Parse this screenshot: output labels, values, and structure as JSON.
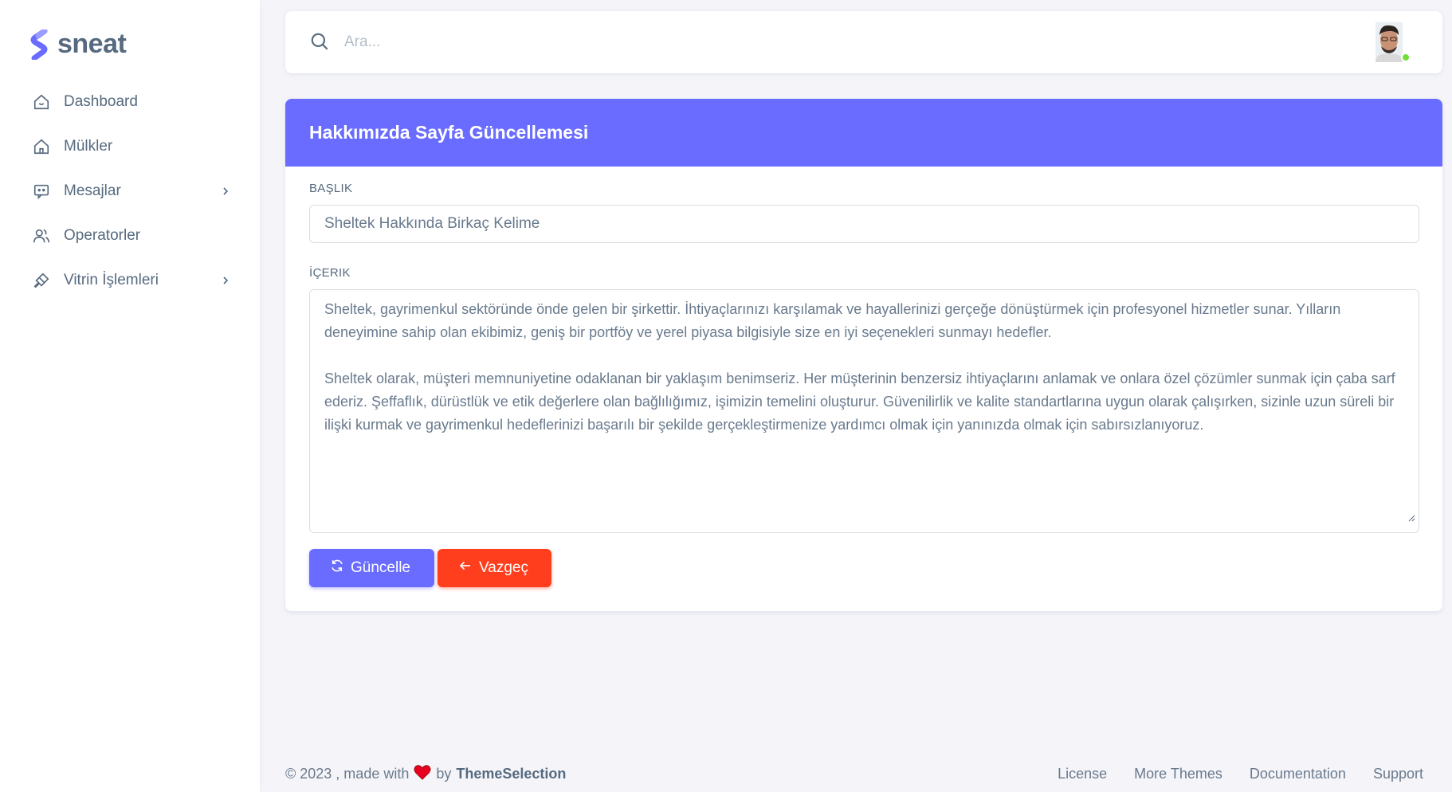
{
  "brand": {
    "name": "sneat",
    "accent": "#696cff"
  },
  "sidebar": {
    "items": [
      {
        "label": "Dashboard",
        "icon": "home-smile-icon",
        "has_arrow": false
      },
      {
        "label": "Mülkler",
        "icon": "home-icon",
        "has_arrow": false
      },
      {
        "label": "Mesajlar",
        "icon": "chat-icon",
        "has_arrow": true
      },
      {
        "label": "Operatorler",
        "icon": "users-icon",
        "has_arrow": false
      },
      {
        "label": "Vitrin İşlemleri",
        "icon": "brush-icon",
        "has_arrow": true
      }
    ]
  },
  "navbar": {
    "search_placeholder": "Ara...",
    "status_color": "#71dd37"
  },
  "card": {
    "title": "Hakkımızda Sayfa Güncellemesi",
    "title_field": {
      "label": "BAŞLIK",
      "value": "Sheltek Hakkında Birkaç Kelime"
    },
    "content_field": {
      "label": "İÇERIK",
      "paragraphs": [
        "Sheltek, gayrimenkul sektöründe önde gelen bir şirkettir. İhtiyaçlarınızı karşılamak ve hayallerinizi gerçeğe dönüştürmek için profesyonel hizmetler sunar. Yılların deneyimine sahip olan ekibimiz, geniş bir portföy ve yerel piyasa bilgisiyle size en iyi seçenekleri sunmayı hedefler.",
        "Sheltek olarak, müşteri memnuniyetine odaklanan bir yaklaşım benimseriz. Her müşterinin benzersiz ihtiyaçlarını anlamak ve onlara özel çözümler sunmak için çaba sarf ederiz. Şeffaflık, dürüstlük ve etik değerlere olan bağlılığımız, işimizin temelini oluşturur. Güvenilirlik ve kalite standartlarına uygun olarak çalışırken, sizinle uzun süreli bir ilişki kurmak ve gayrimenkul hedeflerinizi başarılı bir şekilde gerçekleştirmenize yardımcı olmak için yanınızda olmak için sabırsızlanıyoruz."
      ]
    },
    "update_button": "Güncelle",
    "cancel_button": "Vazgeç",
    "colors": {
      "primary": "#696cff",
      "danger": "#ff3e1d"
    }
  },
  "footer": {
    "copyright": "© 2023 , made with",
    "by": "by",
    "company": "ThemeSelection",
    "links": [
      "License",
      "More Themes",
      "Documentation",
      "Support"
    ]
  }
}
